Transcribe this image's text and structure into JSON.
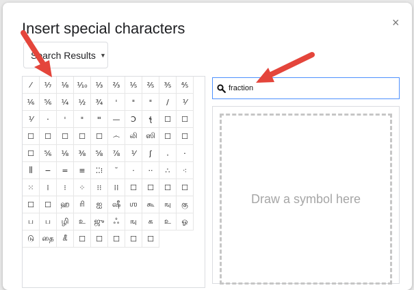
{
  "dialog": {
    "title": "Insert special characters",
    "close_glyph": "×"
  },
  "category": {
    "selected": "Search Results"
  },
  "search": {
    "value": "fraction",
    "icon": "search-icon"
  },
  "draw": {
    "placeholder": "Draw a symbol here"
  },
  "symbols": [
    "⁄",
    "⅐",
    "⅛",
    "⅒",
    "⅓",
    "⅔",
    "⅕",
    "⅖",
    "⅗",
    "⅘",
    "⅙",
    "⅚",
    "¼",
    "½",
    "¾",
    "𐄇",
    "𐄈",
    "𐄈",
    "∕",
    "⅟",
    "⅟",
    "𐄁",
    "𐄇",
    "𐄈",
    "𐄉",
    "—",
    "ꓛ",
    "ꞎ",
    "☐",
    "☐",
    "☐",
    "☐",
    "☐",
    "☐",
    "☐",
    "෴",
    "லி",
    "ஸி",
    "☐",
    "☐",
    "☐",
    "⅚",
    "⅛",
    "⅜",
    "⅝",
    "⅞",
    "⅟",
    "ʃ",
    "𐄀",
    "𐄁",
    "⫼",
    "−",
    "=",
    "≡",
    "⁚⁚⁝",
    "˘",
    "·",
    "··",
    "∴",
    "⁖",
    "⁙",
    "⁞",
    "⁝",
    "⁘",
    "⁝⁝",
    "⁞⁞",
    "☐",
    "☐",
    "☐",
    "☐",
    "☐",
    "☐",
    "ஹ",
    "ரி",
    "ஐ",
    "ஷீ",
    "ஶ",
    "கூ",
    "ஙு",
    "கு",
    "ப",
    "ப",
    "ழி",
    "உ",
    "ஜு",
    "ஃ",
    "ஙு",
    "க",
    "உ",
    "ஓ",
    "டு",
    "தை",
    "கீ",
    "☐",
    "☐",
    "☐",
    "☐",
    "☐"
  ],
  "arrows": {
    "color": "#e4453b"
  }
}
